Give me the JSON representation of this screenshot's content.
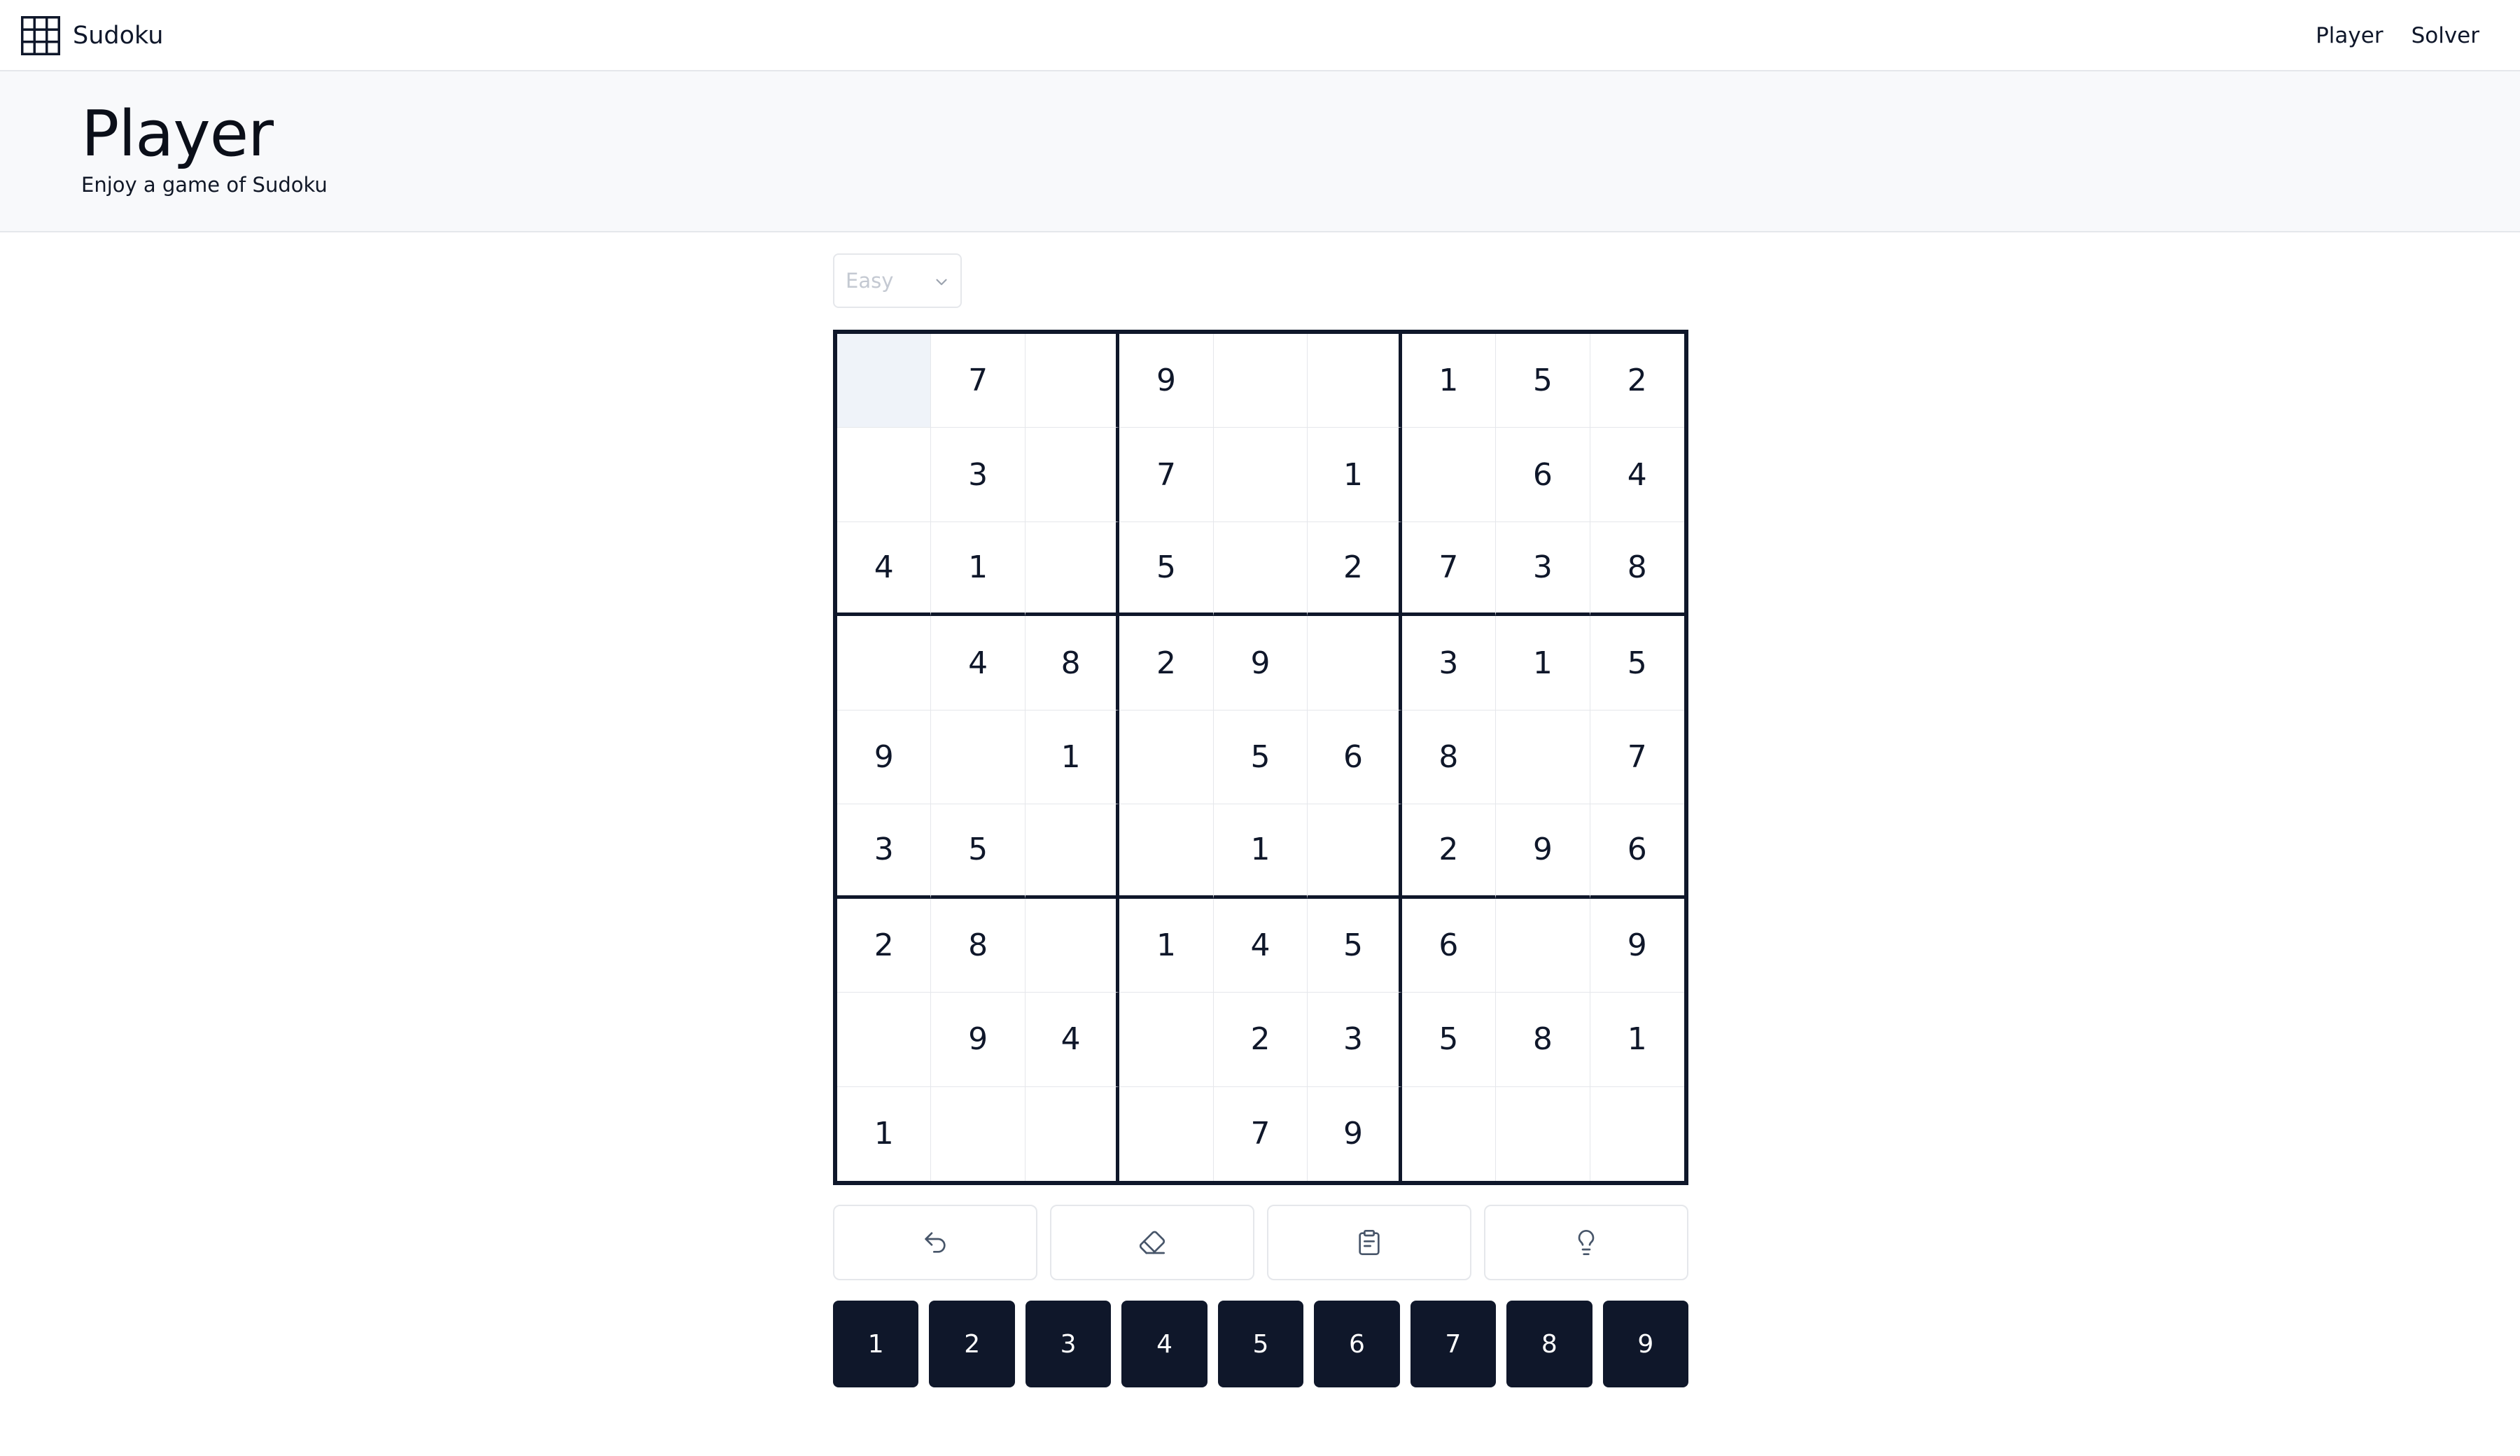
{
  "navbar": {
    "brand": "Sudoku",
    "brand_icon": "grid-icon",
    "links": [
      "Player",
      "Solver"
    ]
  },
  "header": {
    "title": "Player",
    "subtitle": "Enjoy a game of Sudoku"
  },
  "difficulty": {
    "selected": "Easy",
    "icon": "chevron-down-icon"
  },
  "board": {
    "selected_cell": {
      "row": 0,
      "col": 0
    },
    "rows": [
      [
        "",
        "7",
        "",
        "9",
        "",
        "",
        "1",
        "5",
        "2"
      ],
      [
        "",
        "3",
        "",
        "7",
        "",
        "1",
        "",
        "6",
        "4"
      ],
      [
        "4",
        "1",
        "",
        "5",
        "",
        "2",
        "7",
        "3",
        "8"
      ],
      [
        "",
        "4",
        "8",
        "2",
        "9",
        "",
        "3",
        "1",
        "5"
      ],
      [
        "9",
        "",
        "1",
        "",
        "5",
        "6",
        "8",
        "",
        "7"
      ],
      [
        "3",
        "5",
        "",
        "",
        "1",
        "",
        "2",
        "9",
        "6"
      ],
      [
        "2",
        "8",
        "",
        "1",
        "4",
        "5",
        "6",
        "",
        "9"
      ],
      [
        "",
        "9",
        "4",
        "",
        "2",
        "3",
        "5",
        "8",
        "1"
      ],
      [
        "1",
        "",
        "",
        "",
        "7",
        "9",
        "",
        "",
        ""
      ]
    ]
  },
  "actions": [
    {
      "name": "undo",
      "icon": "undo-icon"
    },
    {
      "name": "erase",
      "icon": "eraser-icon"
    },
    {
      "name": "notes",
      "icon": "notes-icon"
    },
    {
      "name": "hint",
      "icon": "lightbulb-icon"
    }
  ],
  "numpad": [
    "1",
    "2",
    "3",
    "4",
    "5",
    "6",
    "7",
    "8",
    "9"
  ],
  "colors": {
    "primary": "#0f172a",
    "selected_cell": "#eff3f9",
    "header_bg": "#f8f9fb",
    "border": "#e5e7eb"
  }
}
